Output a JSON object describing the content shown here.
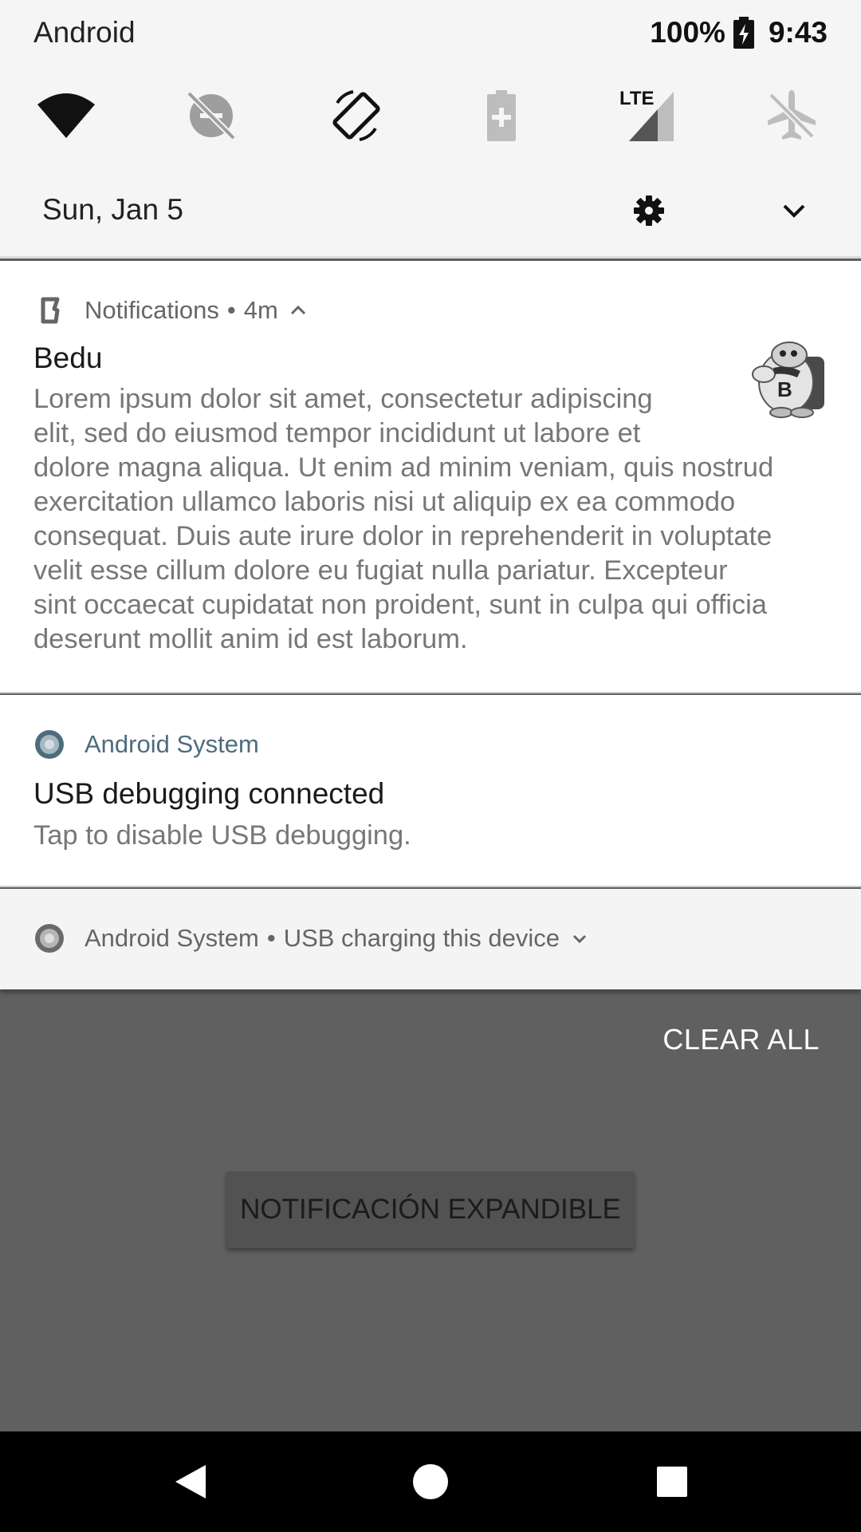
{
  "status_bar": {
    "carrier": "Android",
    "battery_percent": "100%",
    "time": "9:43"
  },
  "quick_tiles": [
    {
      "icon": "wifi-icon"
    },
    {
      "icon": "do-not-disturb-off-icon"
    },
    {
      "icon": "auto-rotate-icon"
    },
    {
      "icon": "battery-saver-icon"
    },
    {
      "icon": "lte-signal-icon",
      "text": "LTE"
    },
    {
      "icon": "airplane-mode-icon"
    }
  ],
  "shade": {
    "date": "Sun, Jan 5"
  },
  "notifications": [
    {
      "app_name": "Notifications",
      "separator": "•",
      "time": "4m",
      "title": "Bedu",
      "body": [
        "Lorem ipsum dolor sit amet, consectetur adipiscing",
        "elit, sed do eiusmod tempor incididunt ut labore et",
        "dolore magna aliqua. Ut enim ad minim veniam, quis nostrud",
        "exercitation ullamco laboris nisi ut aliquip ex ea commodo",
        "consequat. Duis aute irure dolor in reprehenderit in voluptate",
        "velit esse cillum dolore eu fugiat nulla pariatur. Excepteur",
        "sint occaecat cupidatat non proident, sunt in culpa qui officia",
        "deserunt mollit anim id est laborum."
      ],
      "thumb_text": "B"
    },
    {
      "app_name": "Android System",
      "title": "USB debugging connected",
      "body": "Tap to disable USB debugging."
    },
    {
      "app_name": "Android System",
      "separator": "•",
      "subtext": "USB charging this device"
    }
  ],
  "clear_all_label": "CLEAR ALL",
  "app_button_label": "NOTIFICACIÓN EXPANDIBLE",
  "colors": {
    "shade_bg": "#f5f5f5",
    "card_bg": "#ffffff",
    "scrim": "#606060",
    "android_system_accent": "#4e6c7c"
  }
}
